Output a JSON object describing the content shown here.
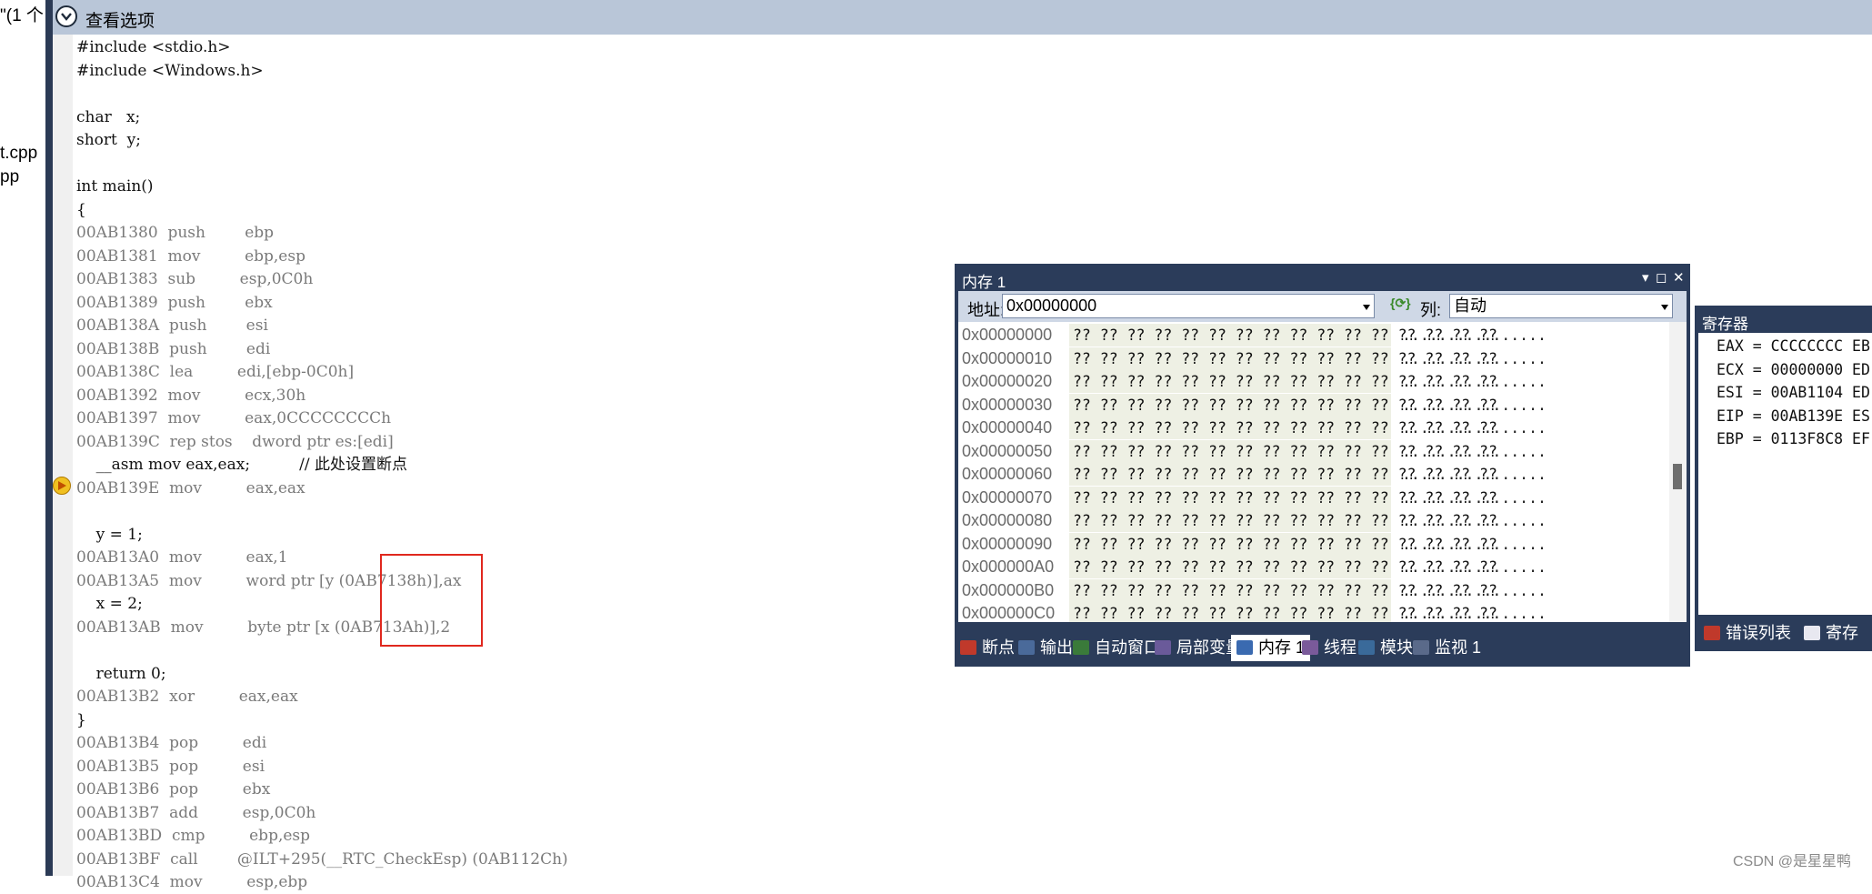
{
  "left_panel": {
    "frag1": "\"(1 个",
    "frag2": "t.cpp",
    "frag3": "pp"
  },
  "header": {
    "title": "查看选项"
  },
  "code_lines": [
    {
      "text": "#include <stdio.h>",
      "kind": "src"
    },
    {
      "text": "#include <Windows.h>",
      "kind": "src"
    },
    {
      "text": "",
      "kind": "src"
    },
    {
      "text": "char   x;",
      "kind": "src"
    },
    {
      "text": "short  y;",
      "kind": "src"
    },
    {
      "text": "",
      "kind": "src"
    },
    {
      "text": "int main()",
      "kind": "src"
    },
    {
      "text": "{",
      "kind": "src"
    },
    {
      "text": "00AB1380  push        ebp",
      "kind": "addr"
    },
    {
      "text": "00AB1381  mov         ebp,esp",
      "kind": "addr"
    },
    {
      "text": "00AB1383  sub         esp,0C0h",
      "kind": "addr"
    },
    {
      "text": "00AB1389  push        ebx",
      "kind": "addr"
    },
    {
      "text": "00AB138A  push        esi",
      "kind": "addr"
    },
    {
      "text": "00AB138B  push        edi",
      "kind": "addr"
    },
    {
      "text": "00AB138C  lea         edi,[ebp-0C0h]",
      "kind": "addr"
    },
    {
      "text": "00AB1392  mov         ecx,30h",
      "kind": "addr"
    },
    {
      "text": "00AB1397  mov         eax,0CCCCCCCCh",
      "kind": "addr"
    },
    {
      "text": "00AB139C  rep stos    dword ptr es:[edi]",
      "kind": "addr"
    },
    {
      "text": "    __asm mov eax,eax;          // 此处设置断点",
      "kind": "src"
    },
    {
      "text": "00AB139E  mov         eax,eax",
      "kind": "addr"
    },
    {
      "text": "",
      "kind": "src"
    },
    {
      "text": "    y = 1;",
      "kind": "src"
    },
    {
      "text": "00AB13A0  mov         eax,1",
      "kind": "addr"
    },
    {
      "text": "00AB13A5  mov         word ptr [y (0AB7138h)],ax",
      "kind": "addr"
    },
    {
      "text": "    x = 2;",
      "kind": "src"
    },
    {
      "text": "00AB13AB  mov         byte ptr [x (0AB713Ah)],2",
      "kind": "addr"
    },
    {
      "text": "",
      "kind": "src"
    },
    {
      "text": "    return 0;",
      "kind": "src"
    },
    {
      "text": "00AB13B2  xor         eax,eax",
      "kind": "addr"
    },
    {
      "text": "}",
      "kind": "src"
    },
    {
      "text": "00AB13B4  pop         edi",
      "kind": "addr"
    },
    {
      "text": "00AB13B5  pop         esi",
      "kind": "addr"
    },
    {
      "text": "00AB13B6  pop         ebx",
      "kind": "addr"
    },
    {
      "text": "00AB13B7  add         esp,0C0h",
      "kind": "addr"
    },
    {
      "text": "00AB13BD  cmp         ebp,esp",
      "kind": "addr"
    },
    {
      "text": "00AB13BF  call        @ILT+295(__RTC_CheckEsp) (0AB112Ch)",
      "kind": "addr"
    },
    {
      "text": "00AB13C4  mov         esp,ebp",
      "kind": "addr"
    }
  ],
  "memory_window": {
    "title": "内存 1",
    "address_label": "地址:",
    "address_value": "0x00000000",
    "columns_label": "列:",
    "columns_value": "自动",
    "rows": [
      {
        "addr": "0x00000000",
        "hex": "?? ?? ?? ?? ?? ?? ?? ?? ?? ?? ?? ?? ?? ?? ?? ??",
        "ascii": "................"
      },
      {
        "addr": "0x00000010",
        "hex": "?? ?? ?? ?? ?? ?? ?? ?? ?? ?? ?? ?? ?? ?? ?? ??",
        "ascii": "................"
      },
      {
        "addr": "0x00000020",
        "hex": "?? ?? ?? ?? ?? ?? ?? ?? ?? ?? ?? ?? ?? ?? ?? ??",
        "ascii": "................"
      },
      {
        "addr": "0x00000030",
        "hex": "?? ?? ?? ?? ?? ?? ?? ?? ?? ?? ?? ?? ?? ?? ?? ??",
        "ascii": "................"
      },
      {
        "addr": "0x00000040",
        "hex": "?? ?? ?? ?? ?? ?? ?? ?? ?? ?? ?? ?? ?? ?? ?? ??",
        "ascii": "................"
      },
      {
        "addr": "0x00000050",
        "hex": "?? ?? ?? ?? ?? ?? ?? ?? ?? ?? ?? ?? ?? ?? ?? ??",
        "ascii": "................"
      },
      {
        "addr": "0x00000060",
        "hex": "?? ?? ?? ?? ?? ?? ?? ?? ?? ?? ?? ?? ?? ?? ?? ??",
        "ascii": "................"
      },
      {
        "addr": "0x00000070",
        "hex": "?? ?? ?? ?? ?? ?? ?? ?? ?? ?? ?? ?? ?? ?? ?? ??",
        "ascii": "................"
      },
      {
        "addr": "0x00000080",
        "hex": "?? ?? ?? ?? ?? ?? ?? ?? ?? ?? ?? ?? ?? ?? ?? ??",
        "ascii": "................"
      },
      {
        "addr": "0x00000090",
        "hex": "?? ?? ?? ?? ?? ?? ?? ?? ?? ?? ?? ?? ?? ?? ?? ??",
        "ascii": "................"
      },
      {
        "addr": "0x000000A0",
        "hex": "?? ?? ?? ?? ?? ?? ?? ?? ?? ?? ?? ?? ?? ?? ?? ??",
        "ascii": "................"
      },
      {
        "addr": "0x000000B0",
        "hex": "?? ?? ?? ?? ?? ?? ?? ?? ?? ?? ?? ?? ?? ?? ?? ??",
        "ascii": "................"
      },
      {
        "addr": "0x000000C0",
        "hex": "?? ?? ?? ?? ?? ?? ?? ?? ?? ?? ?? ?? ?? ?? ?? ??",
        "ascii": "................"
      }
    ],
    "tabs": [
      {
        "label": "断点",
        "icon": "breakpoint-icon",
        "active": false
      },
      {
        "label": "输出",
        "icon": "output-icon",
        "active": false
      },
      {
        "label": "自动窗口",
        "icon": "autos-icon",
        "active": false
      },
      {
        "label": "局部变量",
        "icon": "locals-icon",
        "active": false
      },
      {
        "label": "内存 1",
        "icon": "memory-icon",
        "active": true
      },
      {
        "label": "线程",
        "icon": "threads-icon",
        "active": false
      },
      {
        "label": "模块",
        "icon": "modules-icon",
        "active": false
      },
      {
        "label": "监视 1",
        "icon": "watch-icon",
        "active": false
      }
    ]
  },
  "register_window": {
    "title": "寄存器",
    "rows": [
      "EAX = CCCCCCCC EB",
      "ECX = 00000000 ED",
      "ESI = 00AB1104 ED",
      "EIP = 00AB139E ES",
      "EBP = 0113F8C8 EF"
    ],
    "tabs": [
      {
        "label": "错误列表",
        "icon": "error-list-icon"
      },
      {
        "label": "寄存",
        "icon": "registers-icon"
      }
    ]
  },
  "watermark": "CSDN @是星星鸭"
}
